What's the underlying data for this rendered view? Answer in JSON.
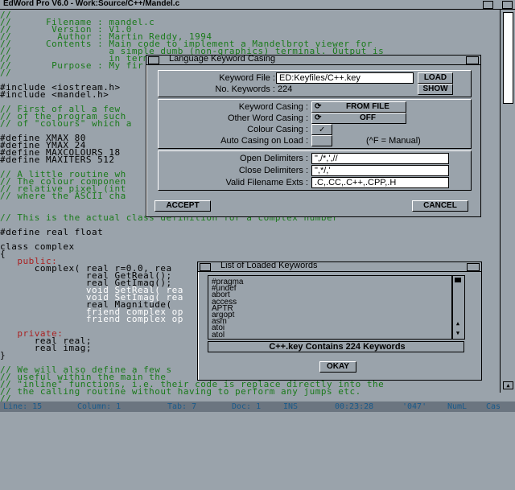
{
  "window": {
    "title": "EdWord Pro V6.0 - Work:Source/C++/Mandel.c"
  },
  "editor": {
    "lines": [
      {
        "t": "//",
        "c": "cmt"
      },
      {
        "t": "//      Filename : mandel.c",
        "c": "cmt"
      },
      {
        "t": "//       Version : V1.0",
        "c": "cmt"
      },
      {
        "t": "//        Author : Martin Reddy, 1994",
        "c": "cmt"
      },
      {
        "t": "//      Contents : Main code to implement a Mandelbrot viewer for",
        "c": "cmt"
      },
      {
        "t": "//                 a simple dumb (non-graphics) terminal. Output is",
        "c": "cmt"
      },
      {
        "t": "//                 in terms of characters rather than colour pixels.",
        "c": "cmt"
      },
      {
        "t": "//       Purpose : My fir",
        "c": "cmt"
      },
      {
        "t": "//",
        "c": "cmt"
      },
      {
        "t": "",
        "c": "txt"
      },
      {
        "t": "#include <iostream.h>",
        "c": "txt"
      },
      {
        "t": "#include <mandel.h>",
        "c": "txt"
      },
      {
        "t": "",
        "c": "txt"
      },
      {
        "t": "// First of all a few",
        "c": "cmt"
      },
      {
        "t": "// of the program such",
        "c": "cmt"
      },
      {
        "t": "// of \"colours\" which a",
        "c": "cmt"
      },
      {
        "t": "",
        "c": "txt"
      },
      {
        "t": "#define XMAX 80",
        "c": "txt"
      },
      {
        "t": "#define YMAX 24",
        "c": "txt"
      },
      {
        "t": "#define MAXCOLOURS 18",
        "c": "txt"
      },
      {
        "t": "#define MAXITERS 512",
        "c": "txt"
      },
      {
        "t": "",
        "c": "txt"
      },
      {
        "t": "// A little routine wh",
        "c": "cmt"
      },
      {
        "t": "// The colour componen",
        "c": "cmt"
      },
      {
        "t": "// relative pixel (int",
        "c": "cmt"
      },
      {
        "t": "// where the ASCII cha",
        "c": "cmt"
      },
      {
        "t": "",
        "c": "txt"
      },
      {
        "t": "",
        "c": "txt"
      },
      {
        "t": "// This is the actual class definition for a complex number",
        "c": "cmt"
      },
      {
        "t": "",
        "c": "txt"
      },
      {
        "t": "#define real float",
        "c": "txt"
      },
      {
        "t": "",
        "c": "txt"
      },
      {
        "t": "class complex",
        "c": "txt"
      },
      {
        "t": "{",
        "c": "txt"
      },
      {
        "t": "   public:",
        "c": "red"
      },
      {
        "t": "      complex( real r=0.0, rea",
        "c": "txt"
      },
      {
        "t": "               real GetReal();",
        "c": "txt"
      },
      {
        "t": "               real GetImag();",
        "c": "txt"
      },
      {
        "t": "               void SetReal( rea",
        "c": "wht"
      },
      {
        "t": "               void SetImag( rea",
        "c": "wht"
      },
      {
        "t": "               real Magnitude( ",
        "c": "txt"
      },
      {
        "t": "               friend complex op",
        "c": "wht"
      },
      {
        "t": "               friend complex op",
        "c": "wht"
      },
      {
        "t": "",
        "c": "txt"
      },
      {
        "t": "   private:",
        "c": "red"
      },
      {
        "t": "      real real;",
        "c": "txt"
      },
      {
        "t": "      real imag;",
        "c": "txt"
      },
      {
        "t": "}",
        "c": "txt"
      },
      {
        "t": "",
        "c": "txt"
      },
      {
        "t": "// We will also define a few s",
        "c": "cmt"
      },
      {
        "t": "// useful within the main the",
        "c": "cmt"
      },
      {
        "t": "// \"inline\" functions, i.e. their code is replace directly into the",
        "c": "cmt"
      },
      {
        "t": "// the calling routine without having to perform any jumps etc.",
        "c": "cmt"
      },
      {
        "t": "//",
        "c": "cmt"
      }
    ]
  },
  "status": {
    "line": "Line: 15",
    "column": "Column: 1",
    "tab": "Tab: 7",
    "doc": "Doc: 1",
    "ins": "INS",
    "time": "00:23:28",
    "char": "'047'",
    "numl": "NumL",
    "caps": "Cas"
  },
  "keyword_dialog": {
    "title": "Language Keyword Casing",
    "keyword_file_label": "Keyword File :",
    "keyword_file_value": "ED:Keyfiles/C++.key",
    "load_label": "LOAD",
    "no_keywords_label": "No. Keywords :",
    "no_keywords_value": "224",
    "show_label": "SHOW",
    "keyword_casing_label": "Keyword Casing :",
    "keyword_casing_value": "FROM FILE",
    "other_word_casing_label": "Other Word Casing :",
    "other_word_casing_value": "OFF",
    "colour_casing_label": "Colour Casing :",
    "colour_casing_mark": "✓",
    "auto_casing_label": "Auto Casing on Load :",
    "auto_casing_hint": "(^F = Manual)",
    "open_delims_label": "Open Delimiters :",
    "open_delims_value": "\",/*,',//",
    "close_delims_label": "Close Delimiters :",
    "close_delims_value": "\",*/,'",
    "valid_exts_label": "Valid Filename Exts :",
    "valid_exts_value": ".C,.CC,.C++,.CPP,.H",
    "accept_label": "ACCEPT",
    "cancel_label": "CANCEL"
  },
  "loaded_keywords": {
    "title": "List of Loaded Keywords",
    "items": [
      "#pragma",
      "#undef",
      "abort",
      "access",
      "APTR",
      "argopt",
      "asm",
      "atoi",
      "atol"
    ],
    "summary": "C++.key Contains 224 Keywords",
    "okay_label": "OKAY"
  }
}
